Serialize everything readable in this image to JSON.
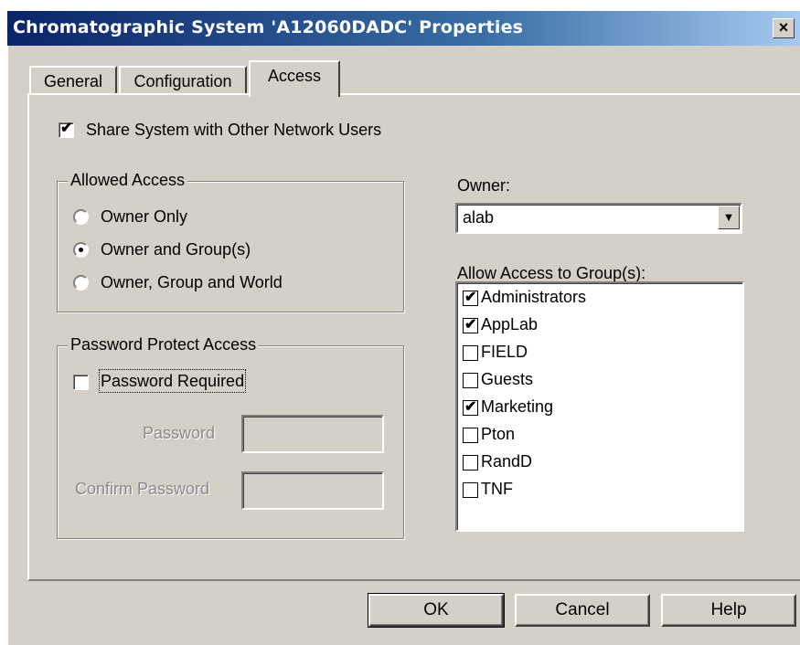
{
  "window": {
    "title": "Chromatographic System 'A12060DADC' Properties",
    "close_glyph": "×"
  },
  "tabs": [
    {
      "label": "General",
      "active": false
    },
    {
      "label": "Configuration",
      "active": false
    },
    {
      "label": "Access",
      "active": true
    }
  ],
  "share": {
    "label": "Share System with Other Network Users",
    "checked": true
  },
  "allowed_access": {
    "legend": "Allowed Access",
    "options": [
      {
        "label": "Owner Only",
        "selected": false
      },
      {
        "label": "Owner and Group(s)",
        "selected": true
      },
      {
        "label": "Owner, Group and World",
        "selected": false
      }
    ]
  },
  "password_protect": {
    "legend": "Password Protect Access",
    "required_label": "Password Required",
    "required_checked": false,
    "password_label": "Password",
    "password_value": "",
    "confirm_label": "Confirm Password",
    "confirm_value": ""
  },
  "owner": {
    "label": "Owner:",
    "value": "alab"
  },
  "groups": {
    "label": "Allow Access to Group(s):",
    "items": [
      {
        "name": "Administrators",
        "checked": true
      },
      {
        "name": "AppLab",
        "checked": true
      },
      {
        "name": "FIELD",
        "checked": false
      },
      {
        "name": "Guests",
        "checked": false
      },
      {
        "name": "Marketing",
        "checked": true
      },
      {
        "name": "Pton",
        "checked": false
      },
      {
        "name": "RandD",
        "checked": false
      },
      {
        "name": "TNF",
        "checked": false
      }
    ]
  },
  "buttons": {
    "ok": "OK",
    "cancel": "Cancel",
    "help": "Help"
  },
  "icons": {
    "check": "✔",
    "dropdown": "▼"
  }
}
